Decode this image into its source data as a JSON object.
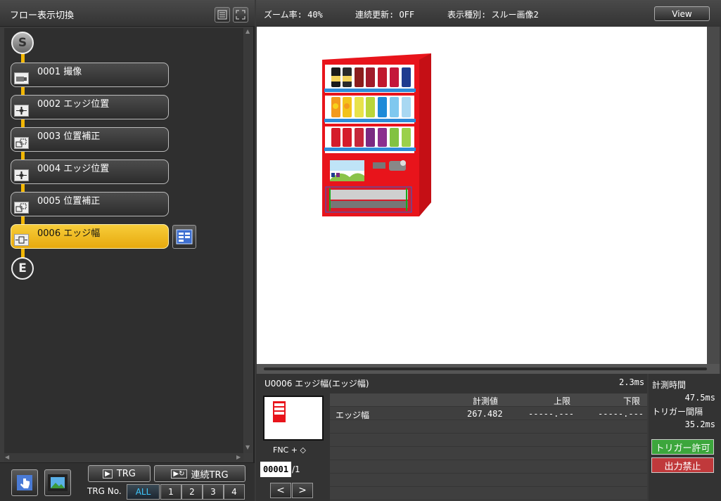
{
  "flow_panel": {
    "title": "フロー表示切換",
    "start_label": "S",
    "end_label": "E",
    "steps": [
      {
        "label": "0001 撮像",
        "icon": "camera-icon"
      },
      {
        "label": "0002 エッジ位置",
        "icon": "edge-position-icon"
      },
      {
        "label": "0003 位置補正",
        "icon": "position-correction-icon"
      },
      {
        "label": "0004 エッジ位置",
        "icon": "edge-position-icon"
      },
      {
        "label": "0005 位置補正",
        "icon": "position-correction-icon"
      },
      {
        "label": "0006 エッジ幅",
        "icon": "edge-width-icon",
        "selected": true
      }
    ]
  },
  "bottom_controls": {
    "trg_label": "TRG",
    "continuous_trg_label": "連続TRG",
    "trg_no_label": "TRG No.",
    "trg_numbers": [
      "ALL",
      "1",
      "2",
      "3",
      "4"
    ]
  },
  "top_bar": {
    "zoom": "ズーム率: 40%",
    "continuous_update": "連続更新: OFF",
    "display_type": "表示種別: スルー画像2",
    "view_button": "View"
  },
  "result": {
    "title": "U0006 エッジ幅(エッジ幅)",
    "time": "2.3ms",
    "fnc_label": "FNC + ◇",
    "page_current": "00001",
    "page_total": "/1",
    "prev": "<",
    "next": ">",
    "columns": [
      "計測値",
      "上限",
      "下限"
    ],
    "rows": [
      {
        "name": "エッジ幅",
        "value": "267.482",
        "upper": "-----.---",
        "lower": "-----.---"
      }
    ]
  },
  "side_info": {
    "measure_time_label": "計測時間",
    "measure_time_value": "47.5ms",
    "trigger_interval_label": "トリガー間隔",
    "trigger_interval_value": "35.2ms",
    "trigger_permit_label": "トリガー許可",
    "output_prohibit_label": "出力禁止"
  },
  "colors": {
    "accent_yellow": "#f2b705",
    "trigger_permit_green": "#3ca63c",
    "output_prohibit_red": "#c0393b",
    "all_cyan": "#3ec9ff"
  }
}
